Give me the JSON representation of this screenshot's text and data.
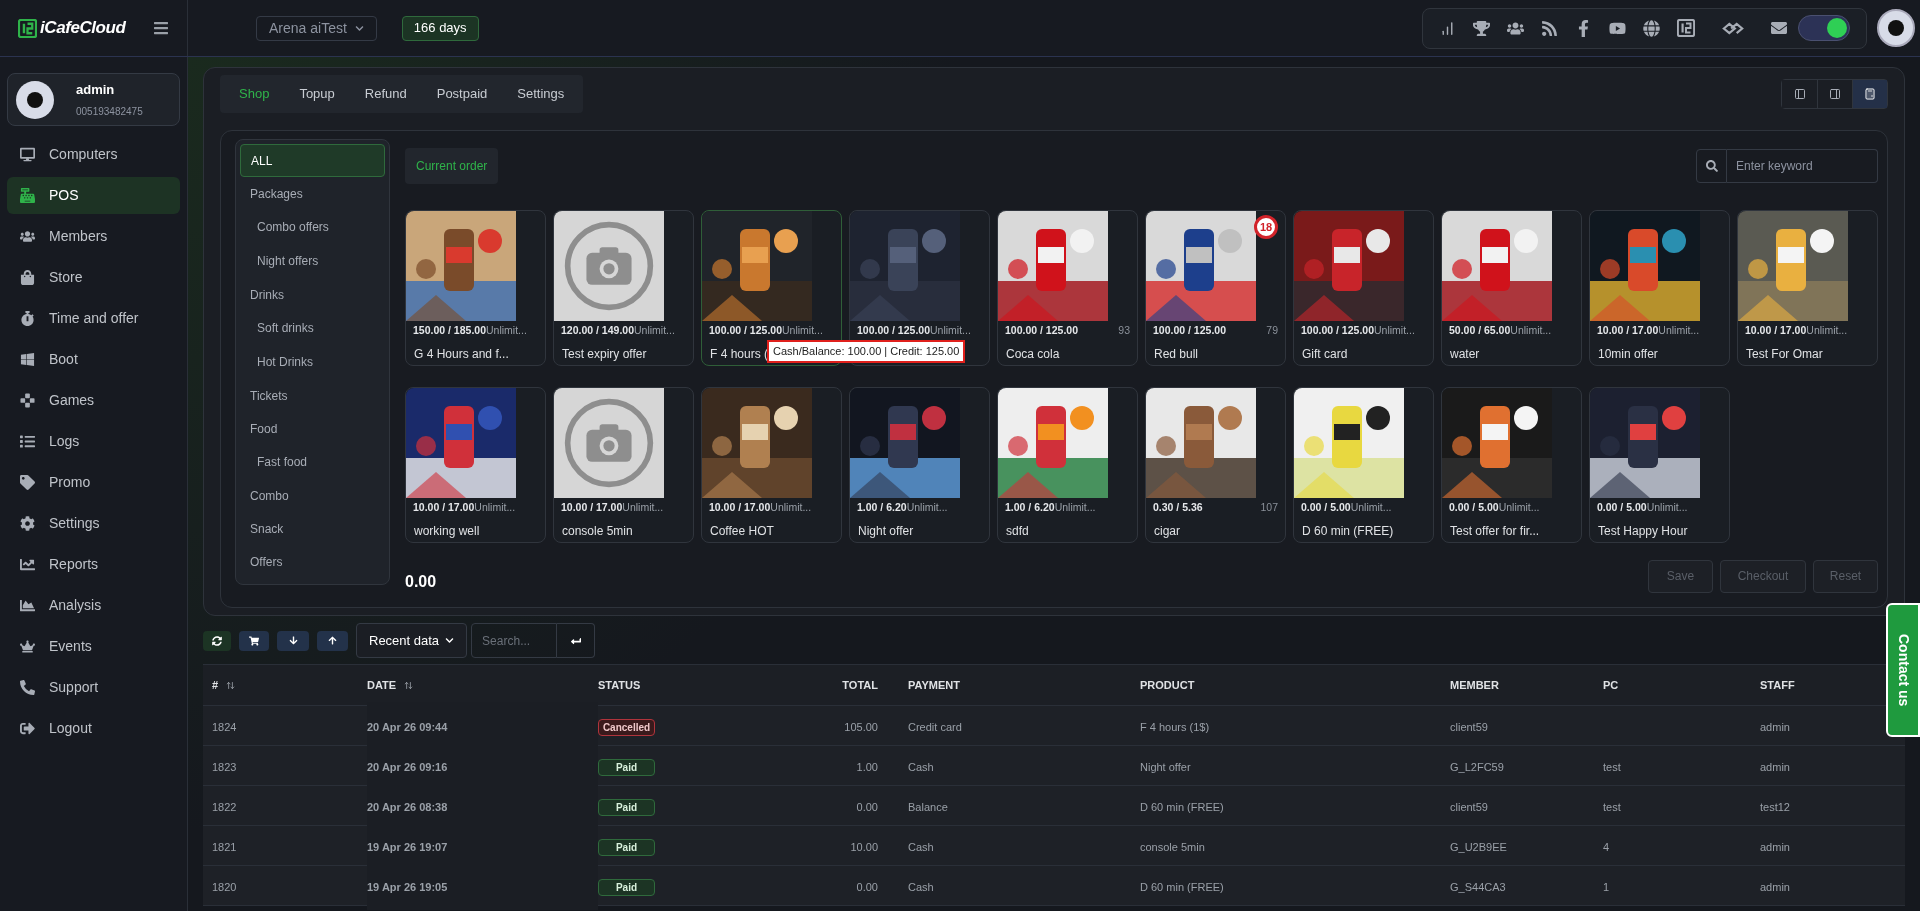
{
  "topbar": {
    "logo": "iCafeCloud",
    "venue": "Arena aiTest",
    "days": "166 days",
    "toggle_on": true
  },
  "profile": {
    "name": "admin",
    "id": "005193482475"
  },
  "nav": [
    {
      "label": "Computers",
      "selected": false
    },
    {
      "label": "POS",
      "selected": true
    },
    {
      "label": "Members",
      "selected": false
    },
    {
      "label": "Store",
      "selected": false
    },
    {
      "label": "Time and offer",
      "selected": false
    },
    {
      "label": "Boot",
      "selected": false
    },
    {
      "label": "Games",
      "selected": false
    },
    {
      "label": "Logs",
      "selected": false
    },
    {
      "label": "Promo",
      "selected": false
    },
    {
      "label": "Settings",
      "selected": false
    },
    {
      "label": "Reports",
      "selected": false
    },
    {
      "label": "Analysis",
      "selected": false
    },
    {
      "label": "Events",
      "selected": false
    },
    {
      "label": "Support",
      "selected": false
    },
    {
      "label": "Logout",
      "selected": false
    }
  ],
  "tabs": [
    {
      "label": "Shop",
      "selected": true
    },
    {
      "label": "Topup",
      "selected": false
    },
    {
      "label": "Refund",
      "selected": false
    },
    {
      "label": "Postpaid",
      "selected": false
    },
    {
      "label": "Settings",
      "selected": false
    }
  ],
  "view_buttons": [
    {
      "selected": false
    },
    {
      "selected": false
    },
    {
      "selected": true
    }
  ],
  "categories": [
    {
      "label": "ALL",
      "selected": true
    },
    {
      "label": "Packages",
      "selected": false,
      "children": [
        {
          "label": "Combo offers",
          "selected": false
        },
        {
          "label": "Night offers",
          "selected": false
        }
      ]
    },
    {
      "label": "Drinks",
      "selected": false,
      "children": [
        {
          "label": "Soft drinks",
          "selected": false
        },
        {
          "label": "Hot Drinks",
          "selected": false
        }
      ]
    },
    {
      "label": "Tickets",
      "selected": false
    },
    {
      "label": "Food",
      "selected": false,
      "children": [
        {
          "label": "Fast food",
          "selected": false
        }
      ]
    },
    {
      "label": "Combo",
      "selected": false
    },
    {
      "label": "Snack",
      "selected": false
    },
    {
      "label": "Offers",
      "selected": false
    }
  ],
  "current_order": "Current order",
  "search": {
    "placeholder": "Enter keyword"
  },
  "products": [
    {
      "price": "150.00 / 185.00",
      "extra": "Unlimit...",
      "name": "G 4 Hours and f...",
      "kind": "picture",
      "hovered": false
    },
    {
      "price": "120.00 / 149.00",
      "extra": "Unlimit...",
      "name": "Test expiry offer",
      "kind": "placeholder",
      "hovered": false
    },
    {
      "price": "100.00 / 125.00",
      "extra": "Unlimit...",
      "name": "F 4 hours (",
      "kind": "picture",
      "hovered": true,
      "tooltip": "Cash/Balance: 100.00 | Credit: 125.00"
    },
    {
      "price": "100.00 / 125.00",
      "extra": "Unlimit...",
      "kind": "picture",
      "hovered": false
    },
    {
      "price": "100.00 / 125.00",
      "stock": "93",
      "name": "Coca cola",
      "kind": "picture",
      "hovered": false
    },
    {
      "price": "100.00 / 125.00",
      "stock": "79",
      "name": "Red bull",
      "kind": "picture",
      "hovered": false,
      "badge": "18"
    },
    {
      "price": "100.00 / 125.00",
      "extra": "Unlimit...",
      "name": "Gift card",
      "kind": "picture",
      "hovered": false
    },
    {
      "price": "50.00 / 65.00",
      "extra": "Unlimit...",
      "name": "water",
      "kind": "picture",
      "hovered": false
    },
    {
      "price": "10.00 / 17.00",
      "extra": "Unlimit...",
      "name": "10min offer",
      "kind": "picture",
      "hovered": false
    },
    {
      "price": "10.00 / 17.00",
      "extra": "Unlimit...",
      "name": "Test For Omar",
      "kind": "picture",
      "hovered": false
    },
    {
      "price": "10.00 / 17.00",
      "extra": "Unlimit...",
      "name": "working well",
      "kind": "picture",
      "hovered": false
    },
    {
      "price": "10.00 / 17.00",
      "extra": "Unlimit...",
      "name": "console 5min",
      "kind": "placeholder",
      "hovered": false
    },
    {
      "price": "10.00 / 17.00",
      "extra": "Unlimit...",
      "name": "Coffee HOT",
      "kind": "picture",
      "hovered": false
    },
    {
      "price": "1.00 / 6.20",
      "extra": "Unlimit...",
      "name": "Night offer",
      "kind": "picture",
      "hovered": false
    },
    {
      "price": "1.00 / 6.20",
      "extra": "Unlimit...",
      "name": "sdfd",
      "kind": "picture",
      "hovered": false
    },
    {
      "price": "0.30 / 5.36",
      "stock": "107",
      "name": "cigar",
      "kind": "picture",
      "hovered": false
    },
    {
      "price": "0.00 / 5.00",
      "extra": "Unlimit...",
      "name": "D 60 min (FREE)",
      "kind": "picture",
      "hovered": false
    },
    {
      "price": "0.00 / 5.00",
      "extra": "Unlimit...",
      "name": "Test offer for fir...",
      "kind": "picture",
      "hovered": false
    },
    {
      "price": "0.00 / 5.00",
      "extra": "Unlimit...",
      "name": "Test Happy Hour",
      "kind": "picture",
      "hovered": false
    }
  ],
  "total": "0.00",
  "actions": [
    {
      "label": "Save",
      "disabled": true
    },
    {
      "label": "Checkout",
      "disabled": true
    },
    {
      "label": "Reset",
      "disabled": true
    }
  ],
  "history": {
    "range": "Recent data",
    "search_placeholder": "Search...",
    "columns": [
      {
        "label": "#",
        "sortable": true
      },
      {
        "label": "DATE",
        "sortable": true
      },
      {
        "label": "STATUS",
        "sortable": false
      },
      {
        "label": "TOTAL",
        "sortable": false
      },
      {
        "label": "PAYMENT",
        "sortable": false
      },
      {
        "label": "PRODUCT",
        "sortable": false
      },
      {
        "label": "MEMBER",
        "sortable": false
      },
      {
        "label": "PC",
        "sortable": false
      },
      {
        "label": "STAFF",
        "sortable": false
      }
    ],
    "rows": [
      {
        "id": "1824",
        "date": "20 Apr 26 09:44",
        "status": "Cancelled",
        "kind": "cancelled",
        "total": "105.00",
        "payment": "Credit card",
        "product": "F 4 hours (1$)",
        "member": "client59",
        "staff": "admin"
      },
      {
        "id": "1823",
        "date": "20 Apr 26 09:16",
        "status": "Paid",
        "kind": "paid",
        "total": "1.00",
        "payment": "Cash",
        "product": "Night offer",
        "member": "G_L2FC59",
        "pc": "test",
        "staff": "admin"
      },
      {
        "id": "1822",
        "date": "20 Apr 26 08:38",
        "status": "Paid",
        "kind": "paid",
        "total": "0.00",
        "payment": "Balance",
        "product": "D 60 min (FREE)",
        "member": "client59",
        "pc": "test",
        "staff": "test12"
      },
      {
        "id": "1821",
        "date": "19 Apr 26 19:07",
        "status": "Paid",
        "kind": "paid",
        "total": "10.00",
        "payment": "Cash",
        "product": "console 5min",
        "member": "G_U2B9EE",
        "pc": "4",
        "staff": "admin"
      },
      {
        "id": "1820",
        "date": "19 Apr 26 19:05",
        "status": "Paid",
        "kind": "paid",
        "total": "0.00",
        "payment": "Cash",
        "product": "D 60 min (FREE)",
        "member": "G_S44CA3",
        "pc": "1",
        "staff": "admin"
      }
    ]
  },
  "contact": "Contact us"
}
